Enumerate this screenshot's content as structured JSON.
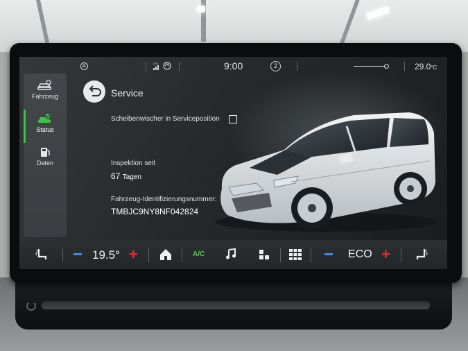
{
  "statusbar": {
    "circle_a": "A",
    "signal_tag": "LTE",
    "time": "9:00",
    "circle_2": "2",
    "temperature": "29.0",
    "temperature_unit": "°C"
  },
  "sidebar": {
    "items": [
      {
        "label": "Fahrzeug",
        "icon": "car-settings-icon",
        "active": false
      },
      {
        "label": "Status",
        "icon": "car-status-icon",
        "active": true
      },
      {
        "label": "Daten",
        "icon": "fuel-data-icon",
        "active": false
      }
    ]
  },
  "header": {
    "title": "Service"
  },
  "service": {
    "wiper_label": "Scheibenwischer in Serviceposition",
    "wiper_checked": false,
    "inspection_label": "Inspektion seit",
    "inspection_value": "67",
    "inspection_unit": "Tagen",
    "vin_label": "Fahrzeug-Identifizierungsnummer:",
    "vin_value": "TMBJC9NY8NF042824"
  },
  "climate": {
    "left_seat_icon": "seat-heating-left-icon",
    "temperature": "19.5°",
    "home_icon": "home-icon",
    "ac_label": "A/C",
    "music_icon": "music-note-icon",
    "apps_icon": "apps-small-icon",
    "grid_icon": "grid-menu-icon",
    "mode": "ECO",
    "right_seat_icon": "seat-heating-right-icon",
    "minus_color": "#3e8fe0",
    "plus_color": "#e52d2d",
    "accent_green": "#3fc24a"
  }
}
